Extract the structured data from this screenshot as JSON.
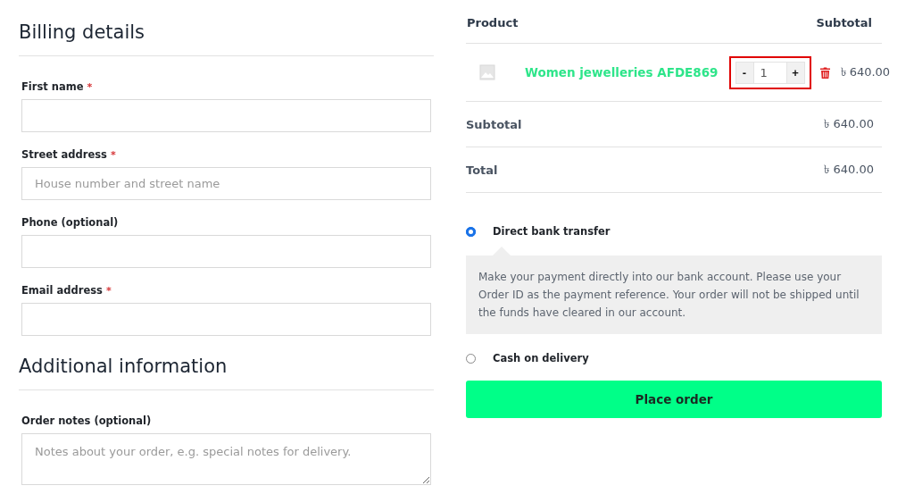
{
  "billing": {
    "title": "Billing details",
    "fields": [
      {
        "label": "First name",
        "required_mark": "*",
        "kind": "input"
      },
      {
        "label": "Street address",
        "required_mark": "*",
        "kind": "input",
        "placeholder": "House number and street name"
      },
      {
        "label": "Phone (optional)",
        "kind": "input"
      },
      {
        "label": "Email address",
        "required_mark": "*",
        "kind": "input"
      }
    ]
  },
  "additional": {
    "title": "Additional information",
    "fields": [
      {
        "label": "Order notes (optional)",
        "kind": "textarea",
        "placeholder": "Notes about your order, e.g. special notes for delivery."
      }
    ]
  },
  "order": {
    "columns": [
      "Product",
      "Subtotal"
    ],
    "items": [
      {
        "name": "Women jewelleries AFDE869",
        "minus": "-",
        "quantity": "1",
        "plus": "+",
        "price": "৳ 640.00",
        "highlighted": true
      }
    ],
    "totals": [
      {
        "label": "Subtotal",
        "value": "৳ 640.00"
      },
      {
        "label": "Total",
        "value": "৳ 640.00"
      }
    ]
  },
  "payment_methods": [
    {
      "label": "Direct bank transfer",
      "selected": true,
      "description": "Make your payment directly into our bank account. Please use your Order ID as the payment reference. Your order will not be shipped until the funds have cleared in our account."
    },
    {
      "label": "Cash on delivery",
      "selected": false
    }
  ],
  "place_order": "Place order"
}
